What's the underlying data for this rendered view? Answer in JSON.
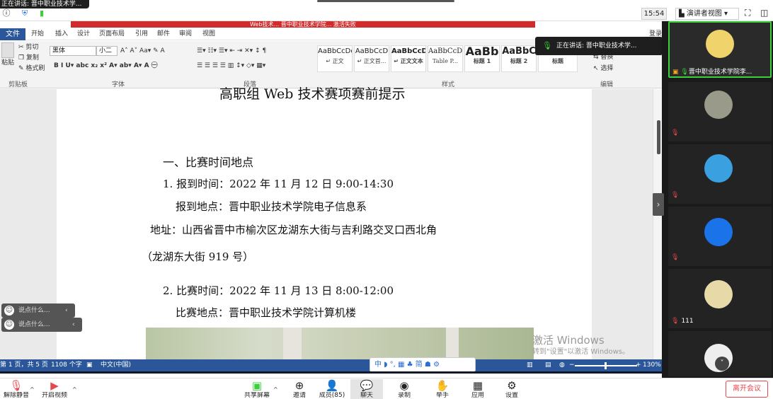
{
  "meeting": {
    "hint_text": "正在讲话: 晋中职业技术学...",
    "clock": "15:54",
    "view_selector": "演讲者视图",
    "speaking_popup": "正在讲话: 晋中职业技术学...",
    "collapse_arrow": "›",
    "participants": [
      {
        "name": "晋中职业技术学院李...",
        "avatar_color": "#f0d36a",
        "speaking": true
      },
      {
        "name": "",
        "avatar_color": "#9a9a8a",
        "speaking": false
      },
      {
        "name": "",
        "avatar_color": "#3aa0e0",
        "speaking": false
      },
      {
        "name": "",
        "avatar_color": "#1a73e8",
        "speaking": false
      },
      {
        "name": "111",
        "avatar_color": "#e8d9a8",
        "speaking": false
      },
      {
        "name": "",
        "avatar_color": "#eeeeee",
        "speaking": false
      }
    ]
  },
  "word": {
    "window_title": "Web技术... 晋中职业技术学院... 激活失败",
    "menu": [
      "文件",
      "开始",
      "插入",
      "设计",
      "页面布局",
      "引用",
      "邮件",
      "审阅",
      "视图"
    ],
    "menu_right": "登录",
    "clipboard": {
      "paste": "粘贴",
      "cut": "剪切",
      "copy": "复制",
      "format_painter": "格式刷",
      "group": "剪贴板"
    },
    "font": {
      "name": "黑体",
      "size": "小二",
      "group": "字体"
    },
    "paragraph_group": "段落",
    "styles": [
      {
        "preview": "AaBbCcDdI",
        "name": "↵ 正文"
      },
      {
        "preview": "AaBbCcD",
        "name": "↵ 正文首..."
      },
      {
        "preview": "AaBbCcD",
        "name": "↵ 正文文本"
      },
      {
        "preview": "AaBbCcDdI",
        "name": "Table P..."
      },
      {
        "preview": "AaBb",
        "name": "标题 1"
      },
      {
        "preview": "AaBbC",
        "name": "标题 2"
      },
      {
        "preview": "AaBbC",
        "name": "标题"
      }
    ],
    "styles_group": "样式",
    "editing": {
      "replace": "替换",
      "select": "选择",
      "group": "编辑"
    },
    "document": {
      "title": "高职组 Web 技术赛项赛前提示",
      "section1": "一、比赛时间地点",
      "line1": "1.  报到时间：2022 年 11 月 12 日  9:00-14:30",
      "line2": "报到地点：晋中职业技术学院电子信息系",
      "line3": "地址：山西省晋中市榆次区龙湖东大街与吉利路交叉口西北角",
      "line4": "（龙湖东大街 919 号）",
      "line5": "2. 比赛时间：2022 年 11 月  13 日 8:00-12:00",
      "line6": "比赛地点：晋中职业技术学院计算机楼"
    },
    "watermark": {
      "line1": "激活 Windows",
      "line2": "转到\"设置\"以激活 Windows。"
    },
    "status": {
      "page": "第 1 页，共 5 页",
      "words": "1108 个字",
      "lang": "中文(中国)",
      "zoom": "130%"
    },
    "ime_text": "中 ◗ °, ▦ ♣ 简 ☗ ⚙"
  },
  "chat_bubbles": [
    "说点什么...",
    "说点什么..."
  ],
  "toolbar": {
    "unmute": "解除静音",
    "start_video": "开启视频",
    "share_screen": "共享屏幕",
    "invite": "邀请",
    "members": "成员(85)",
    "chat": "聊天",
    "record": "录制",
    "raise_hand": "举手",
    "apps": "应用",
    "settings": "设置",
    "leave": "离开会议"
  },
  "colors": {
    "word_blue": "#2b579a",
    "zoom_green": "#3ad13a",
    "mute_red": "#e5484d"
  }
}
